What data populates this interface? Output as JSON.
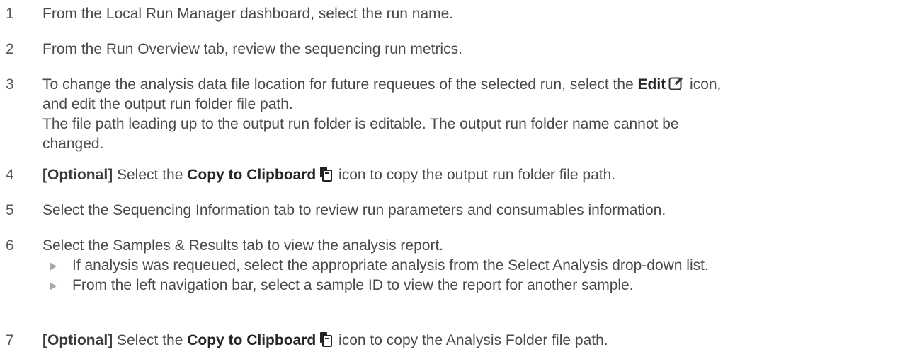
{
  "steps": [
    {
      "number": "1",
      "text": "From the Local Run Manager dashboard, select the run name."
    },
    {
      "number": "2",
      "text": "From the Run Overview tab, review the sequencing run metrics."
    },
    {
      "number": "3",
      "text_before": "To change the analysis data file location for future requeues of the selected run, select the ",
      "bold": "Edit",
      "text_after": " icon,",
      "line2": "and edit the output run folder file path.",
      "note_line1": "The file path leading up to the output run folder is editable. The output run folder name cannot be",
      "note_line2": "changed.",
      "icon": "edit-icon"
    },
    {
      "number": "4",
      "prefix": "[Optional]",
      "text_before": " Select the ",
      "bold": "Copy to Clipboard",
      "text_after": " icon to copy the output run folder file path.",
      "icon": "clipboard-icon"
    },
    {
      "number": "5",
      "text": "Select the Sequencing Information tab to review run parameters and consumables information."
    },
    {
      "number": "6",
      "text": "Select the Samples & Results tab to view the analysis report.",
      "bullets": [
        "If analysis was requeued, select the appropriate analysis from the Select Analysis drop-down list.",
        "From the left navigation bar, select a sample ID to view the report for another sample."
      ]
    },
    {
      "number": "7",
      "prefix": "[Optional]",
      "text_before": " Select the ",
      "bold": "Copy to Clipboard",
      "text_after": " icon to copy the Analysis Folder file path.",
      "icon": "clipboard-icon"
    }
  ]
}
